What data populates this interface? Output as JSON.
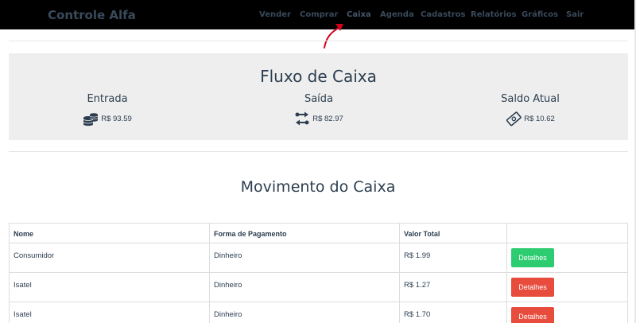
{
  "app": {
    "brand": "Controle Alfa"
  },
  "nav": {
    "items": [
      {
        "label": "Vender"
      },
      {
        "label": "Comprar"
      },
      {
        "label": "Caixa"
      },
      {
        "label": "Agenda"
      },
      {
        "label": "Cadastros"
      },
      {
        "label": "Relatórios"
      },
      {
        "label": "Gráficos"
      },
      {
        "label": "Sair"
      }
    ],
    "active": "Caixa"
  },
  "cash_flow": {
    "title": "Fluxo de Caixa",
    "entrada": {
      "label": "Entrada",
      "value": "R$ 93.59",
      "icon": "coins-icon"
    },
    "saida": {
      "label": "Saída",
      "value": "R$ 82.97",
      "icon": "exchange-icon"
    },
    "saldo": {
      "label": "Saldo Atual",
      "value": "R$ 10.62",
      "icon": "money-bill-icon"
    }
  },
  "movement": {
    "title": "Movimento do Caixa",
    "headers": {
      "nome": "Nome",
      "forma": "Forma de Pagamento",
      "valor": "Valor Total"
    },
    "rows": [
      {
        "nome": "Consumidor",
        "forma": "Dinheiro",
        "valor": "R$ 1.99",
        "button": "Detalhes",
        "button_color": "#2ecc71"
      },
      {
        "nome": "Isatel",
        "forma": "Dinheiro",
        "valor": "R$ 1.27",
        "button": "Detalhes",
        "button_color": "#e74c3c"
      },
      {
        "nome": "Isatel",
        "forma": "Dinheiro",
        "valor": "R$ 1.70",
        "button": "Detalhes",
        "button_color": "#e74c3c"
      }
    ]
  },
  "colors": {
    "navbar_bg": "#000000",
    "panel_bg": "#eeeeee",
    "text": "#2c3e50",
    "annotation_arrow": "#d0021b"
  }
}
